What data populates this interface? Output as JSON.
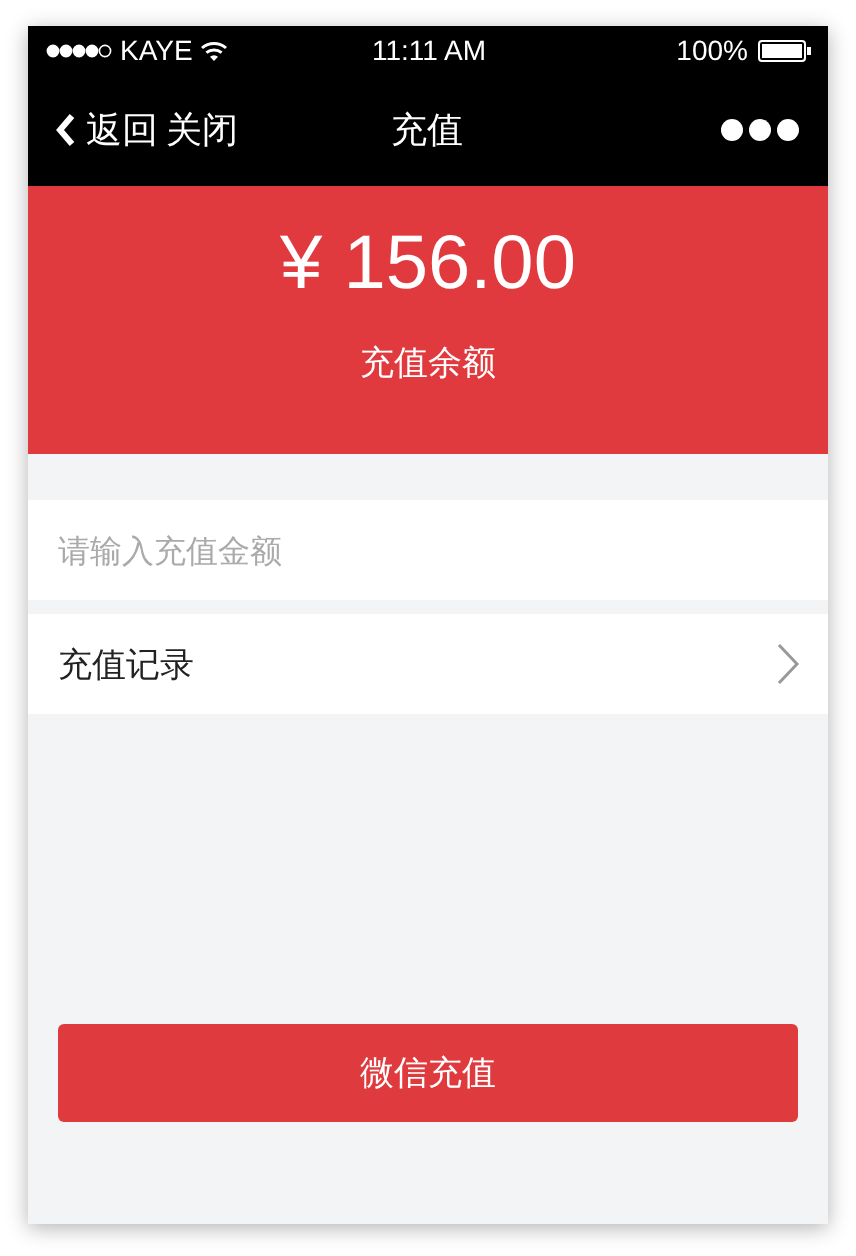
{
  "status_bar": {
    "carrier": "KAYE",
    "time": "11:11 AM",
    "battery": "100%"
  },
  "nav": {
    "back": "返回",
    "close": "关闭",
    "title": "充值"
  },
  "balance": {
    "amount": "¥ 156.00",
    "label": "充值余额"
  },
  "amount_field": {
    "placeholder": "请输入充值金额"
  },
  "records_row": {
    "label": "充值记录"
  },
  "pay_button": {
    "label": "微信充值"
  }
}
